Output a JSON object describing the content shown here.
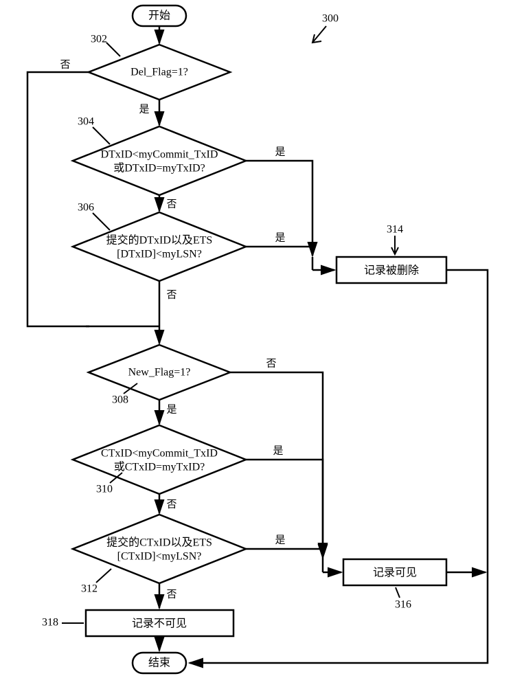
{
  "figure_number": "300",
  "start": "开始",
  "end": "结束",
  "yes": "是",
  "no": "否",
  "node302": {
    "id": "302",
    "line1": "Del_Flag=1?"
  },
  "node304": {
    "id": "304",
    "line1": "DTxID<myCommit_TxID",
    "line2": "或DTxID=myTxID?"
  },
  "node306": {
    "id": "306",
    "line1": "提交的DTxID以及ETS",
    "line2": "[DTxID]<myLSN?"
  },
  "node308": {
    "id": "308",
    "line1": "New_Flag=1?"
  },
  "node310": {
    "id": "310",
    "line1": "CTxID<myCommit_TxID",
    "line2": "或CTxID=myTxID?"
  },
  "node312": {
    "id": "312",
    "line1": "提交的CTxID以及ETS",
    "line2": "[CTxID]<myLSN?"
  },
  "node314": {
    "id": "314",
    "label": "记录被删除"
  },
  "node316": {
    "id": "316",
    "label": "记录可见"
  },
  "node318": {
    "id": "318",
    "label": "记录不可见"
  }
}
